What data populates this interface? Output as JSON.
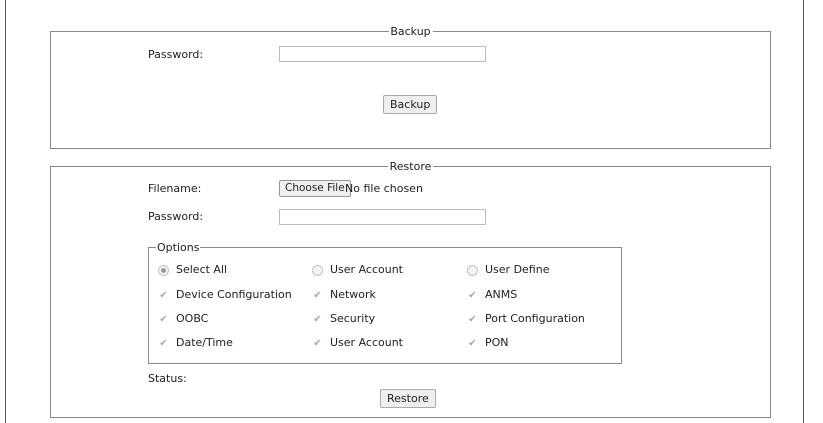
{
  "backup": {
    "legend": "Backup",
    "password_label": "Password:",
    "password_value": "",
    "button_label": "Backup"
  },
  "restore": {
    "legend": "Restore",
    "filename_label": "Filename:",
    "choose_file_label": "Choose File",
    "file_status": "No file chosen",
    "password_label": "Password:",
    "password_value": "",
    "options": {
      "legend": "Options",
      "radios": [
        {
          "label": "Select All",
          "checked": true
        },
        {
          "label": "User Account",
          "checked": false
        },
        {
          "label": "User Define",
          "checked": false
        }
      ],
      "checkboxes": [
        {
          "label": "Device Configuration",
          "checked": true
        },
        {
          "label": "Network",
          "checked": true
        },
        {
          "label": "ANMS",
          "checked": true
        },
        {
          "label": "OOBC",
          "checked": true
        },
        {
          "label": "Security",
          "checked": true
        },
        {
          "label": "Port Configuration",
          "checked": true
        },
        {
          "label": "Date/Time",
          "checked": true
        },
        {
          "label": "User Account",
          "checked": true
        },
        {
          "label": "PON",
          "checked": true
        }
      ]
    },
    "status_label": "Status:",
    "button_label": "Restore"
  },
  "colors": {
    "border": "#888888",
    "button_bg": "#efefef",
    "disabled_mark": "#a8a8a8"
  }
}
